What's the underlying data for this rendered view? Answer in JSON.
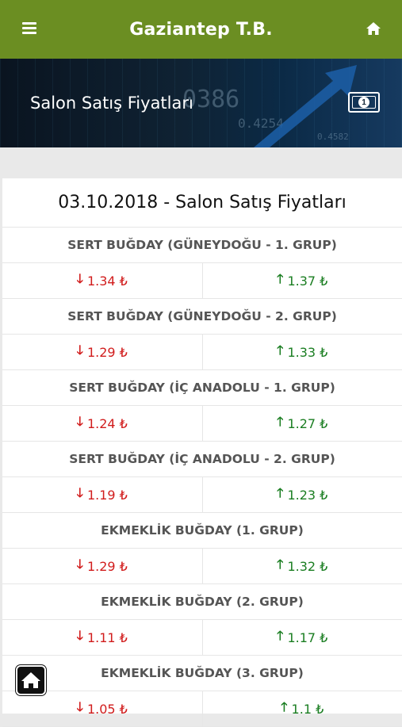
{
  "header": {
    "title": "Gaziantep T.B.",
    "menu_icon": "hamburger-menu-icon",
    "home_icon": "home-icon"
  },
  "banner": {
    "title": "Salon Satış Fiyatları",
    "icon": "money-bill-icon"
  },
  "table": {
    "title": "03.10.2018 - Salon Satış Fiyatları",
    "currency": "₺",
    "groups": [
      {
        "name": "SERT BUĞDAY (GÜNEYDOĞU - 1. GRUP)",
        "min": "1.34 ₺",
        "max": "1.37 ₺"
      },
      {
        "name": "SERT BUĞDAY (GÜNEYDOĞU - 2. GRUP)",
        "min": "1.29 ₺",
        "max": "1.33 ₺"
      },
      {
        "name": "SERT BUĞDAY (İÇ ANADOLU - 1. GRUP)",
        "min": "1.24 ₺",
        "max": "1.27 ₺"
      },
      {
        "name": "SERT BUĞDAY (İÇ ANADOLU - 2. GRUP)",
        "min": "1.19 ₺",
        "max": "1.23 ₺"
      },
      {
        "name": "EKMEKLİK BUĞDAY (1. GRUP)",
        "min": "1.29 ₺",
        "max": "1.32 ₺"
      },
      {
        "name": "EKMEKLİK BUĞDAY (2. GRUP)",
        "min": "1.11 ₺",
        "max": "1.17 ₺"
      },
      {
        "name": "EKMEKLİK BUĞDAY (3. GRUP)",
        "min": "1.05 ₺",
        "max": "1.1 ₺"
      }
    ]
  },
  "colors": {
    "header_green": "#6b8e22",
    "price_down_red": "#d11c1c",
    "price_up_green": "#1b7e22"
  },
  "floating_button": {
    "icon": "home-icon"
  }
}
